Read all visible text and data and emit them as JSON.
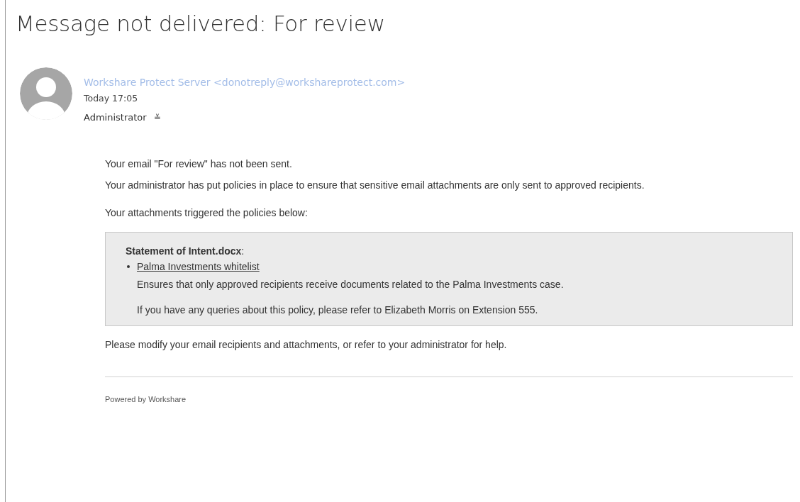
{
  "message": {
    "subject": "Message not delivered: For review",
    "sender": "Workshare Protect Server <donotreply@workshareprotect.com>",
    "time": "Today 17:05",
    "recipient": "Administrator",
    "expand_glyph": "≚"
  },
  "body": {
    "paragraphs": [
      "Your email \"For review\" has not been sent.",
      "Your administrator has put policies in place to ensure that sensitive email attachments are only sent to approved recipients.",
      "Your attachments triggered the policies below:"
    ],
    "policy_box": {
      "file": "**Statement of Intent.docx**:",
      "policies": [
        {
          "name": "Palma Investments whitelist",
          "description": "Ensures that only approved recipients receive documents related to the Palma Investments case.",
          "contact": "If you have any queries about this policy, please refer to Elizabeth Morris on Extension 555."
        }
      ]
    },
    "closing": "Please modify your email recipients and attachments, or refer to your administrator for help.",
    "footer": "Powered by Workshare"
  }
}
